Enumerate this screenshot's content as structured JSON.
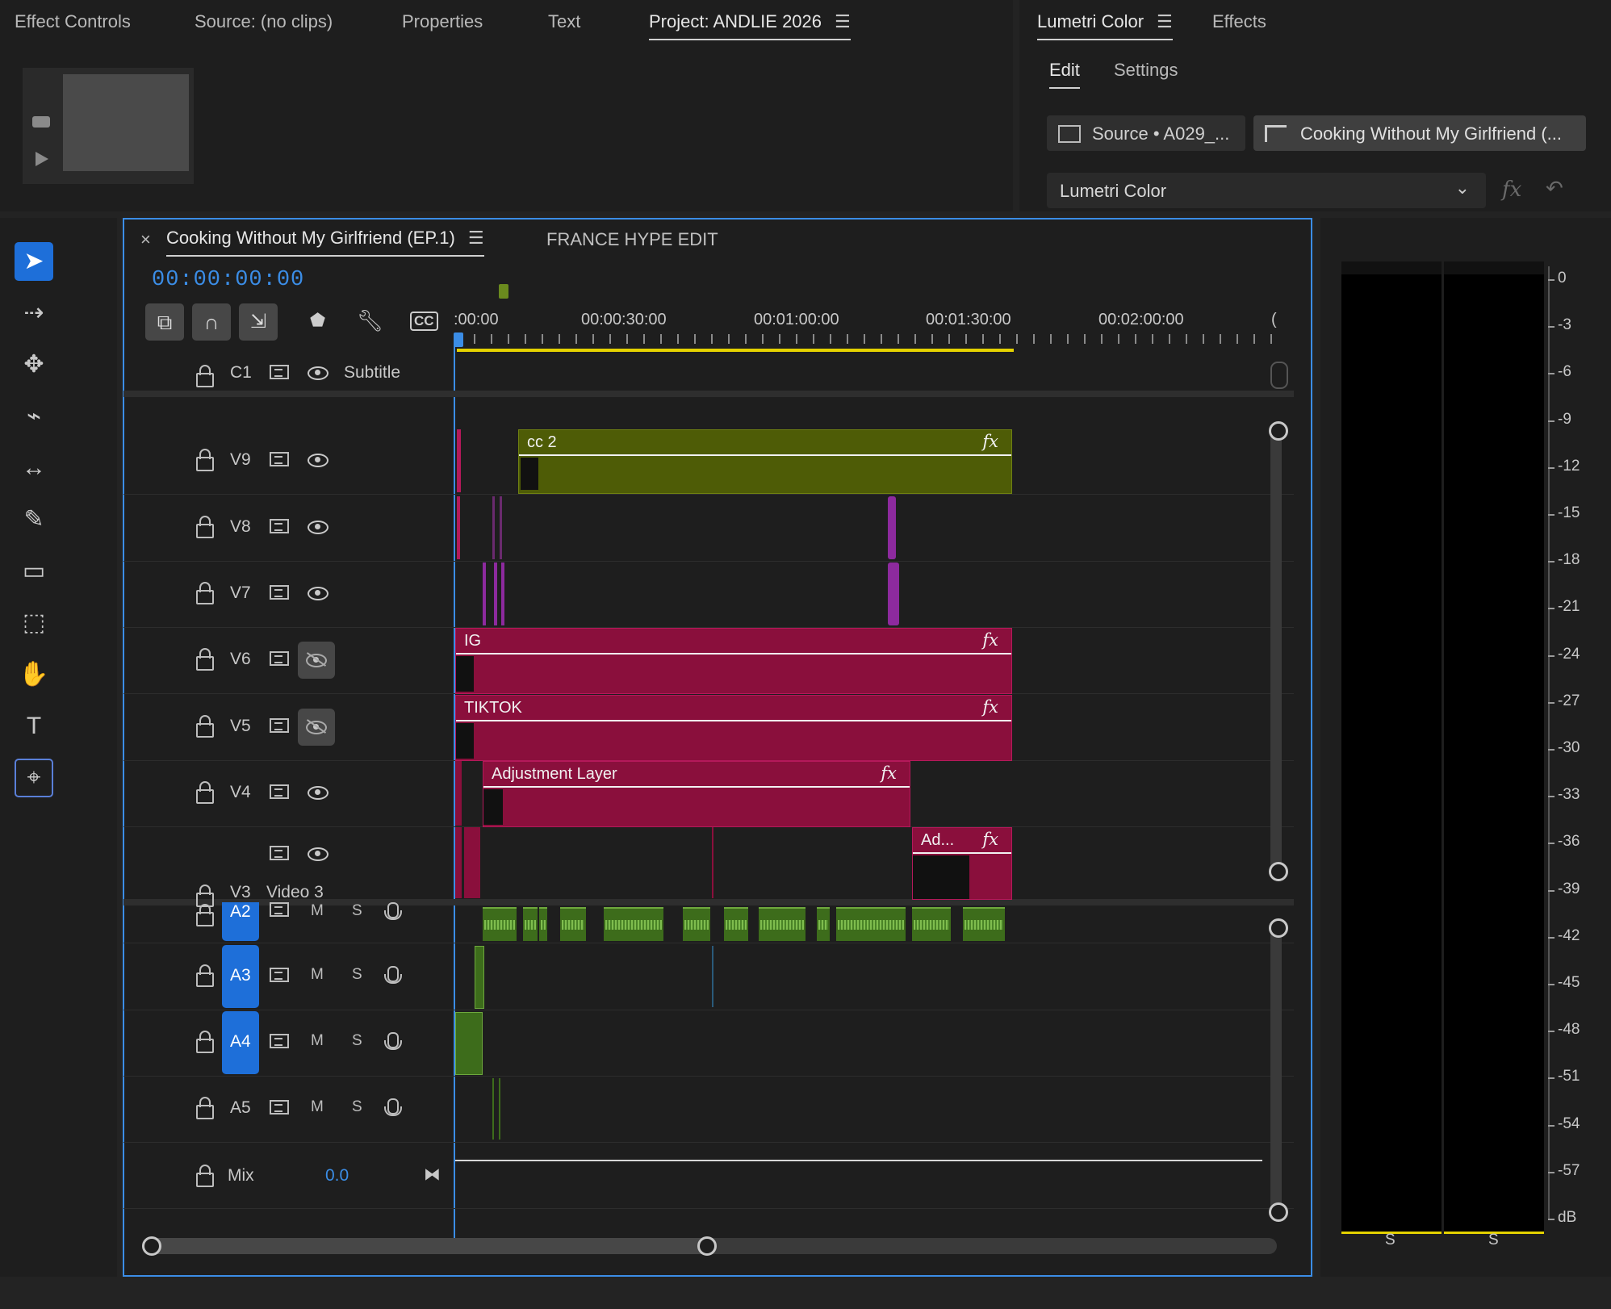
{
  "top_left_tabs": [
    "Effect Controls",
    "Source: (no clips)",
    "Properties",
    "Text",
    "Project: ANDLIE 2026"
  ],
  "top_right_tabs": [
    "Lumetri Color",
    "Effects"
  ],
  "lumetri": {
    "subtabs": [
      "Edit",
      "Settings"
    ],
    "source_btn": "Source • A029_...",
    "sequence_btn": "Cooking Without My Girlfriend (...",
    "effect_select": "Lumetri Color",
    "fx_label": "fx"
  },
  "sequence_tabs": [
    "Cooking Without My Girlfriend (EP.1)",
    "FRANCE HYPE EDIT"
  ],
  "close_glyph": "×",
  "timecode": "00:00:00:00",
  "ruler_labels": [
    ":00:00",
    "00:00:30:00",
    "00:01:00:00",
    "00:01:30:00",
    "00:02:00:00",
    "("
  ],
  "tracks": {
    "caption": {
      "id": "C1",
      "name": "Subtitle"
    },
    "video": [
      "V9",
      "V8",
      "V7",
      "V6",
      "V5",
      "V4",
      "V3"
    ],
    "v3_name": "Video 3",
    "audio": [
      "A2",
      "A3",
      "A4",
      "A5"
    ],
    "mute": "M",
    "solo": "S",
    "mix": {
      "label": "Mix",
      "value": "0.0"
    }
  },
  "clips": {
    "cc2": "cc 2",
    "ig": "IG",
    "tiktok": "TIKTOK",
    "adjustment": "Adjustment Layer",
    "ad_short": "Ad...",
    "fx": "fx"
  },
  "meter": {
    "scale": [
      "0",
      "-3",
      "-6",
      "-9",
      "-12",
      "-15",
      "-18",
      "-21",
      "-24",
      "-27",
      "-30",
      "-33",
      "-36",
      "-39",
      "-42",
      "-45",
      "-48",
      "-51",
      "-54",
      "-57",
      "dB"
    ],
    "channels": [
      "S",
      "S"
    ]
  },
  "colors": {
    "accent_blue": "#1e6fd9",
    "clip_pink": "#8a0f3c",
    "clip_olive": "#4e5c06",
    "audio_green": "#3d6c1b",
    "playhead": "#3b8de6"
  }
}
